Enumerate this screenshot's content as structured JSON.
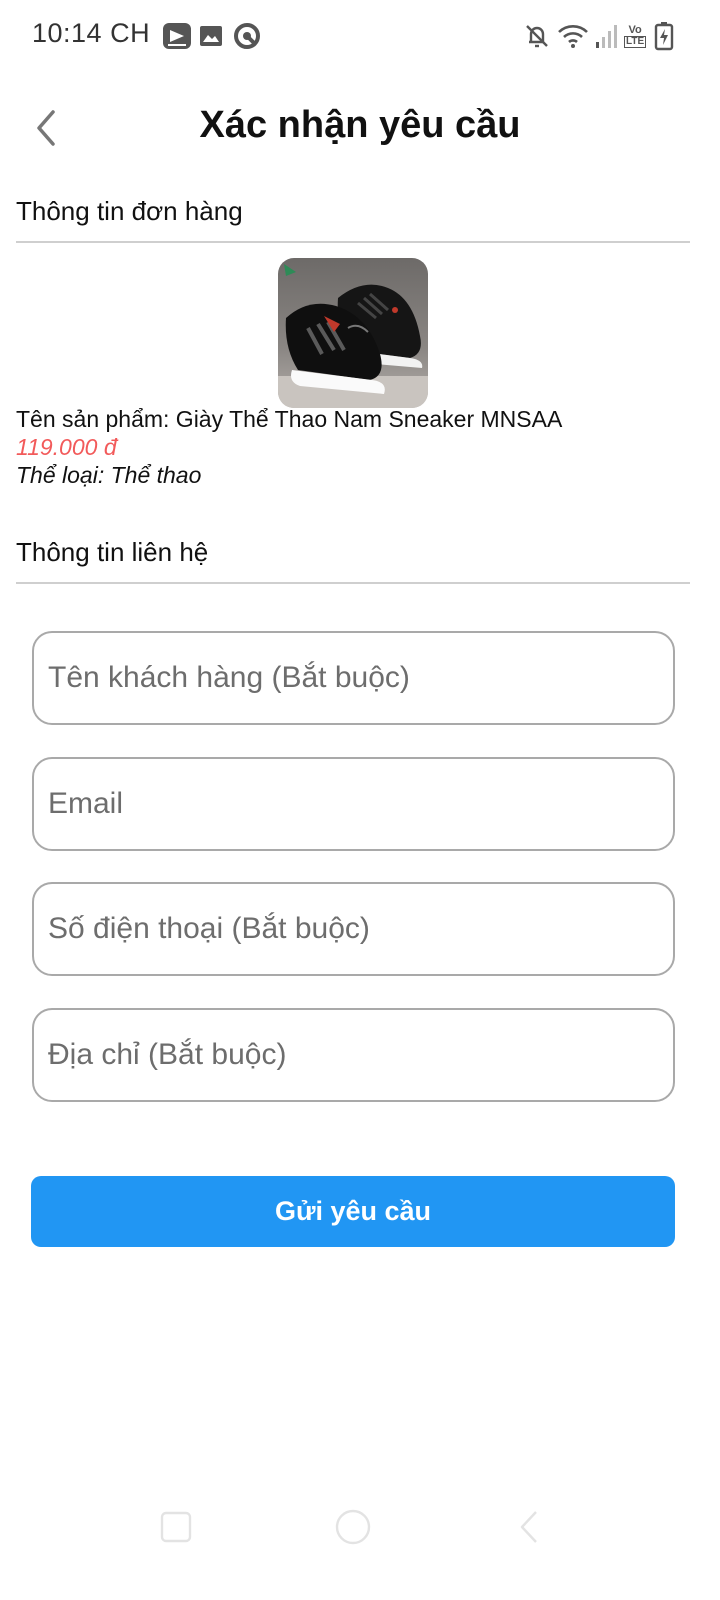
{
  "status_bar": {
    "time": "10:14 CH",
    "icons": [
      "video-app-icon",
      "gallery-icon",
      "app-ring-icon",
      "bell-off-icon",
      "wifi-icon",
      "signal-icon",
      "volte-icon",
      "battery-charging-icon"
    ],
    "volte_label_top": "Vo",
    "volte_label_bottom": "LTE"
  },
  "header": {
    "title": "Xác nhận yêu cầu",
    "back_icon": "chevron-left-icon"
  },
  "order_section": {
    "title": "Thông tin đơn hàng",
    "product": {
      "name": "Tên sản phẩm: Giày Thể Thao Nam Sneaker MNSAA",
      "price": "119.000 đ",
      "category": "Thể loại: Thể thao"
    }
  },
  "contact_section": {
    "title": "Thông tin liên hệ",
    "fields": {
      "name_placeholder": "Tên khách hàng (Bắt buộc)",
      "email_placeholder": "Email",
      "phone_placeholder": "Số điện thoại (Bắt buộc)",
      "address_placeholder": "Địa chỉ (Bắt buộc)"
    }
  },
  "submit_label": "Gửi yêu cầu",
  "colors": {
    "accent": "#2196f3",
    "price": "#f25a5a",
    "divider": "#cfcfcf"
  }
}
